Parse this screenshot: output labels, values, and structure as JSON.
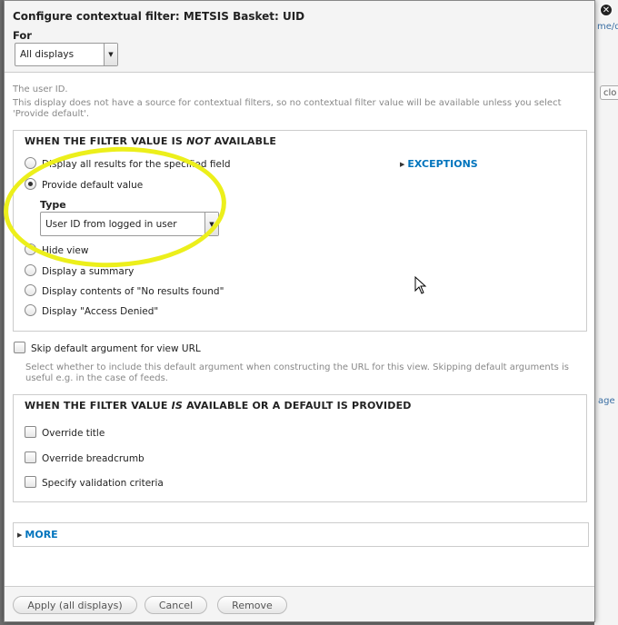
{
  "dialog": {
    "title": "Configure contextual filter: METSIS Basket: UID",
    "for_label": "For",
    "for_select_value": "All displays",
    "help_text_1": "The user ID.",
    "help_text_2": "This display does not have a source for contextual filters, so no contextual filter value will be available unless you select 'Provide default'."
  },
  "not_available": {
    "legend_prefix": "WHEN THE FILTER VALUE IS ",
    "legend_em": "NOT",
    "legend_suffix": " AVAILABLE",
    "exceptions_label": "EXCEPTIONS",
    "options": [
      {
        "label": "Display all results for the specified field",
        "checked": false
      },
      {
        "label": "Provide default value",
        "checked": true
      },
      {
        "label": "Hide view",
        "checked": false
      },
      {
        "label": "Display a summary",
        "checked": false
      },
      {
        "label": "Display contents of \"No results found\"",
        "checked": false
      },
      {
        "label": "Display \"Access Denied\"",
        "checked": false
      }
    ],
    "type_label": "Type",
    "type_select_value": "User ID from logged in user"
  },
  "skip_default": {
    "label": "Skip default argument for view URL",
    "help": "Select whether to include this default argument when constructing the URL for this view. Skipping default arguments is useful e.g. in the case of feeds."
  },
  "available": {
    "legend_prefix": "WHEN THE FILTER VALUE ",
    "legend_em": "IS",
    "legend_suffix": " AVAILABLE OR A DEFAULT IS PROVIDED",
    "checkboxes": [
      {
        "label": "Override title"
      },
      {
        "label": "Override breadcrumb"
      },
      {
        "label": "Specify validation criteria"
      }
    ]
  },
  "more_label": "MORE",
  "footer": {
    "apply_label": "Apply (all displays)",
    "cancel_label": "Cancel",
    "remove_label": "Remove"
  },
  "background": {
    "frag_top": "me/d",
    "frag_close": "clo",
    "frag_age": "age"
  },
  "colors": {
    "link": "#0074bd",
    "highlight": "#ecef1b",
    "dialog_bg": "#ffffff",
    "header_bg": "#f4f4f4"
  },
  "icons": [
    "close-icon",
    "dropdown-arrow-icon",
    "triangle-right-icon",
    "mouse-pointer-icon"
  ]
}
